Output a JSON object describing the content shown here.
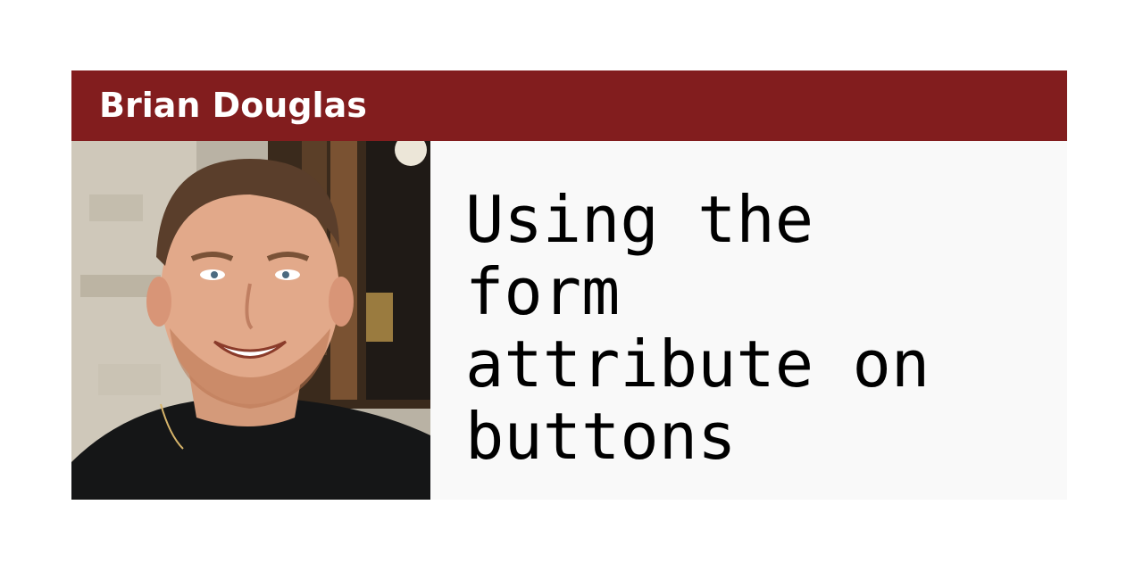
{
  "author": {
    "name": "Brian Douglas"
  },
  "article": {
    "title": "Using the\nform\nattribute on\nbuttons"
  },
  "photo": {
    "subject": "author-portrait"
  },
  "colors": {
    "header_bg": "#821d1e",
    "header_text": "#ffffff",
    "panel_bg": "#f9f9f9",
    "title_text": "#000000"
  }
}
